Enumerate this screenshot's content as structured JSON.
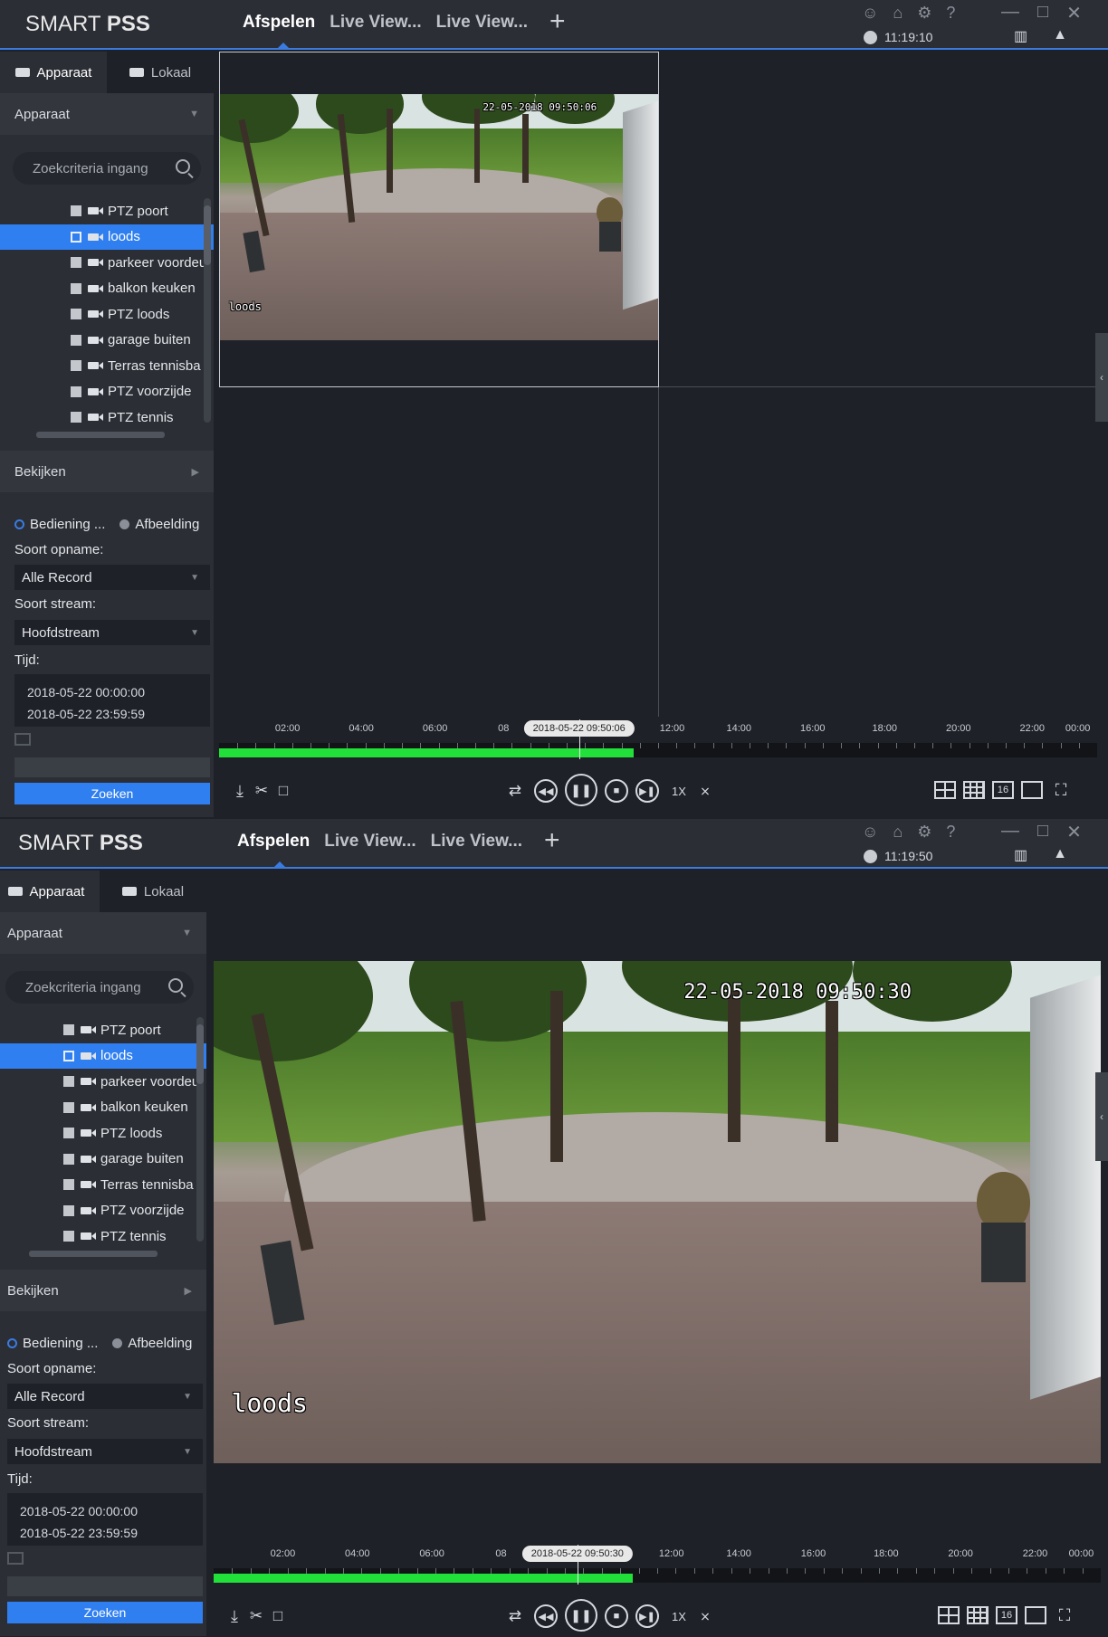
{
  "app": {
    "logo_left": "SMART",
    "logo_right": "PSS",
    "tabs": [
      "Afspelen",
      "Live View...",
      "Live View..."
    ],
    "add_tab": "+",
    "icons": [
      "user-icon",
      "lock-icon",
      "gear-icon",
      "help-icon"
    ],
    "help_glyph": "?",
    "window_controls": [
      "—",
      "□",
      "✕"
    ]
  },
  "screens": [
    {
      "clock": "11:19:10",
      "timeline_bubble": "2018-05-22 09:50:06",
      "osd_time": "22-05-2018 09:50:06",
      "osd_name": "loods"
    },
    {
      "clock": "11:19:50",
      "timeline_bubble": "2018-05-22 09:50:30",
      "osd_time": "22-05-2018 09:50:30",
      "osd_name": "loods"
    }
  ],
  "sidebar": {
    "tab_device": "Apparaat",
    "tab_local": "Lokaal",
    "section_device": "Apparaat",
    "search_placeholder": "Zoekcriteria ingang",
    "devices": [
      "PTZ poort",
      "loods",
      "parkeer voordeu",
      "balkon keuken",
      "PTZ loods",
      "garage buiten",
      "Terras tennisba",
      "PTZ voorzijde",
      "PTZ tennis"
    ],
    "selected_device": "loods",
    "section_view": "Bekijken",
    "radio_control": "Bediening ...",
    "radio_image": "Afbeelding",
    "record_type_label": "Soort opname:",
    "record_type_value": "Alle Record",
    "stream_type_label": "Soort stream:",
    "stream_type_value": "Hoofdstream",
    "time_label": "Tijd:",
    "time_start": "2018-05-22 00:00:00",
    "time_end": "2018-05-22 23:59:59",
    "search_button": "Zoeken"
  },
  "timeline": {
    "labels": [
      "02:00",
      "04:00",
      "06:00",
      "08",
      "12:00",
      "14:00",
      "16:00",
      "18:00",
      "20:00",
      "22:00",
      "00:00"
    ],
    "recorded_until_fraction": 0.472,
    "cursor_fraction": 0.41
  },
  "controls": {
    "speed": "1X",
    "layout16": "16"
  },
  "colors": {
    "accent": "#2f7ff0",
    "record_green": "#22e03a"
  }
}
